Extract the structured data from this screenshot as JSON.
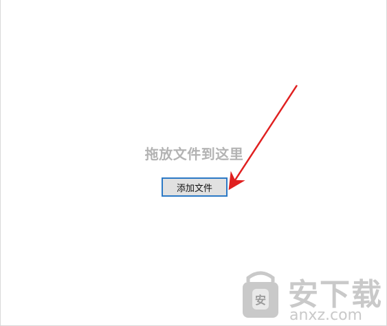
{
  "drop_zone": {
    "hint_text": "拖放文件到这里",
    "add_button_label": "添加文件"
  },
  "annotation": {
    "arrow_color": "#e02020"
  },
  "watermark": {
    "title": "安下载",
    "domain": "anxz.com",
    "color": "#c9c9c9",
    "icon": "shield-lock-icon",
    "icon_text": "安"
  },
  "colors": {
    "hint_text": "#b3b3b3",
    "button_border": "#2a78c5",
    "button_bg": "#e1e1e1"
  }
}
